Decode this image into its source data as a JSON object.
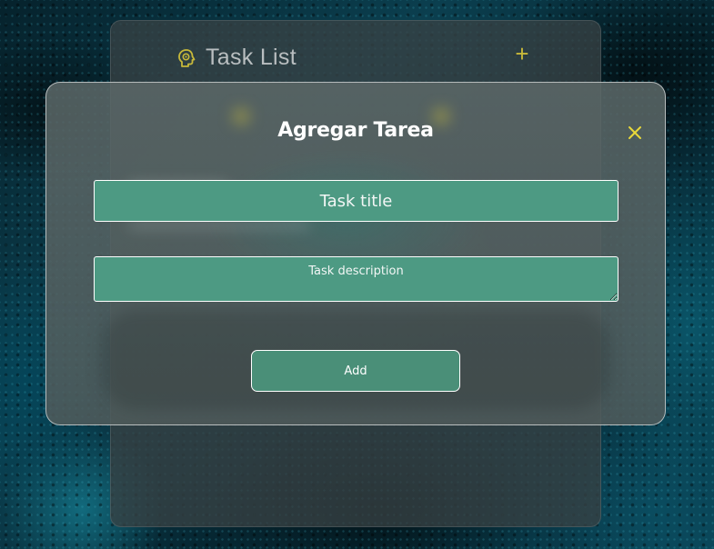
{
  "task_list": {
    "title": "Task List",
    "header_icon": "brain-icon",
    "add_icon": "plus-icon",
    "add_symbol": "+"
  },
  "modal": {
    "title": "Agregar Tarea",
    "close_icon": "close-icon",
    "title_input": {
      "placeholder": "Task title",
      "value": ""
    },
    "description_input": {
      "placeholder": "Task description",
      "value": ""
    },
    "submit_label": "Add"
  },
  "colors": {
    "accent_yellow": "#c8b93a",
    "field_green": "#4d9a83",
    "button_green": "#4a8f78",
    "text_white": "#ffffff"
  }
}
